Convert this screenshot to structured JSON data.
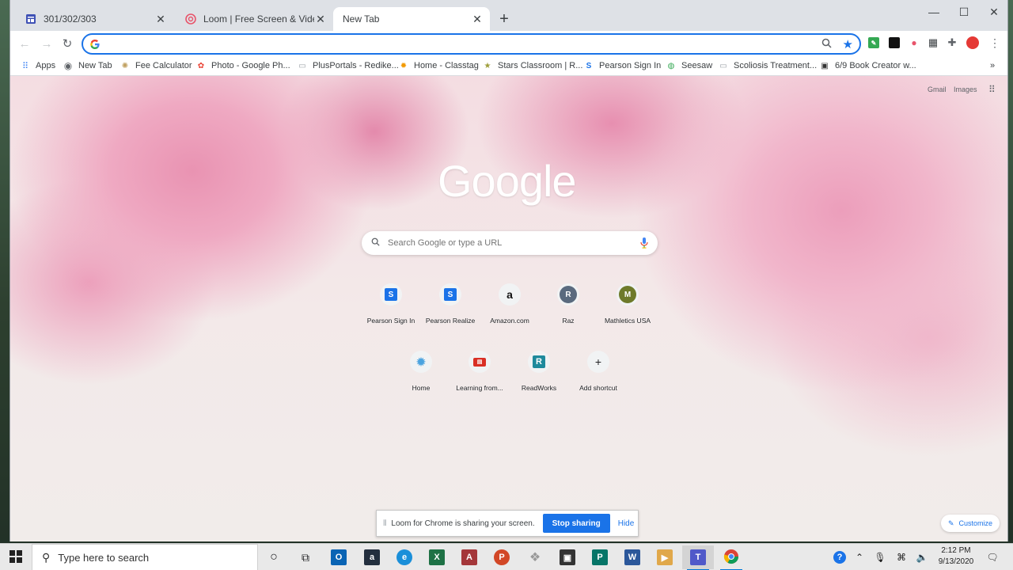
{
  "tabs": [
    {
      "title": "301/302/303",
      "favicon": "google-forms-icon",
      "active": false
    },
    {
      "title": "Loom | Free Screen & Video Recording",
      "favicon": "loom-icon",
      "active": false
    },
    {
      "title": "New Tab",
      "favicon": "",
      "active": true
    }
  ],
  "window_controls": {
    "minimize": "—",
    "maximize": "☐",
    "close": "✕"
  },
  "omnibox": {
    "value": "",
    "placeholder": ""
  },
  "bookmarks": [
    {
      "label": "Apps",
      "icon": "apps-grid-icon"
    },
    {
      "label": "New Tab",
      "icon": "globe-icon"
    },
    {
      "label": "Fee Calculator",
      "icon": "sun-icon"
    },
    {
      "label": "Photo - Google Ph...",
      "icon": "google-photos-icon"
    },
    {
      "label": "PlusPortals - Redike...",
      "icon": "page-icon"
    },
    {
      "label": "Home - Classtag",
      "icon": "classtag-icon"
    },
    {
      "label": "Stars Classroom | R...",
      "icon": "stars-icon"
    },
    {
      "label": "Pearson Sign In",
      "icon": "pearson-icon"
    },
    {
      "label": "Seesaw",
      "icon": "seesaw-icon"
    },
    {
      "label": "Scoliosis Treatment...",
      "icon": "page-icon"
    },
    {
      "label": "6/9 Book Creator w...",
      "icon": "book-creator-icon"
    }
  ],
  "bookmarks_overflow": "»",
  "ntp": {
    "gmail_link": "Gmail",
    "images_link": "Images",
    "logo": "Google",
    "search_placeholder": "Search Google or type a URL",
    "shortcuts_row1": [
      {
        "label": "Pearson Sign In",
        "glyph": "S",
        "color": "#1a73e8"
      },
      {
        "label": "Pearson Realize",
        "glyph": "S",
        "color": "#1a73e8"
      },
      {
        "label": "Amazon.com",
        "glyph": "a",
        "color": "#000000"
      },
      {
        "label": "Raz",
        "glyph": "R",
        "color": "#ffffff"
      },
      {
        "label": "Mathletics USA",
        "glyph": "M",
        "color": "#ffffff"
      }
    ],
    "shortcuts_row2": [
      {
        "label": "Home",
        "glyph": "❁",
        "color": "#4aa3df"
      },
      {
        "label": "Learning from...",
        "glyph": "▤",
        "color": "#d93025"
      },
      {
        "label": "ReadWorks",
        "glyph": "R",
        "color": "#ffffff"
      },
      {
        "label": "Add shortcut",
        "glyph": "+",
        "color": "#202124"
      }
    ],
    "customize_label": "Customize"
  },
  "loom_bar": {
    "message": "Loom for Chrome is sharing your screen.",
    "stop_label": "Stop sharing",
    "hide_label": "Hide"
  },
  "taskbar": {
    "search_placeholder": "Type here to search",
    "time": "2:12 PM",
    "date": "9/13/2020"
  }
}
